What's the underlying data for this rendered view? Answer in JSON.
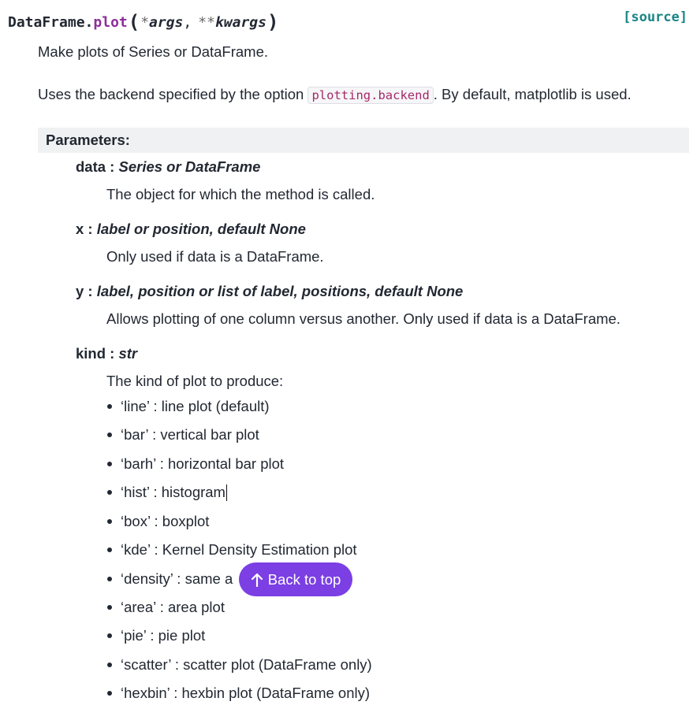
{
  "signature": {
    "class_name": "DataFrame",
    "dot": ".",
    "method": "plot",
    "open_paren": "(",
    "arg1_star": "*",
    "arg1": "args",
    "comma": ",",
    "arg2_star": "**",
    "arg2": "kwargs",
    "close_paren": ")"
  },
  "source_link": "[source]",
  "summary": "Make plots of Series or DataFrame.",
  "backend_text": {
    "before": "Uses the backend specified by the option ",
    "code": "plotting.backend",
    "after": ". By default, matplotlib is used."
  },
  "parameters_heading": "Parameters:",
  "parameters": [
    {
      "name": "data",
      "sep": " : ",
      "type": "Series or DataFrame",
      "desc": "The object for which the method is called."
    },
    {
      "name": "x",
      "sep": " : ",
      "type": "label or position, default None",
      "desc": "Only used if data is a DataFrame."
    },
    {
      "name": "y",
      "sep": " : ",
      "type": "label, position or list of label, positions, default None",
      "desc": "Allows plotting of one column versus another. Only used if data is a DataFrame."
    },
    {
      "name": "kind",
      "sep": " : ",
      "type": "str",
      "desc": "The kind of plot to produce:"
    }
  ],
  "kind_options": [
    "‘line’ : line plot (default)",
    "‘bar’ : vertical bar plot",
    "‘barh’ : horizontal bar plot",
    "‘hist’ : histogram",
    "‘box’ : boxplot",
    "‘kde’ : Kernel Density Estimation plot",
    "‘density’ : same a",
    "‘area’ : area plot",
    "‘pie’ : pie plot",
    "‘scatter’ : scatter plot (DataFrame only)",
    "‘hexbin’ : hexbin plot (DataFrame only)"
  ],
  "back_to_top": {
    "label": "Back to top",
    "icon": "arrow-up-icon",
    "color": "#7b3fe4"
  }
}
